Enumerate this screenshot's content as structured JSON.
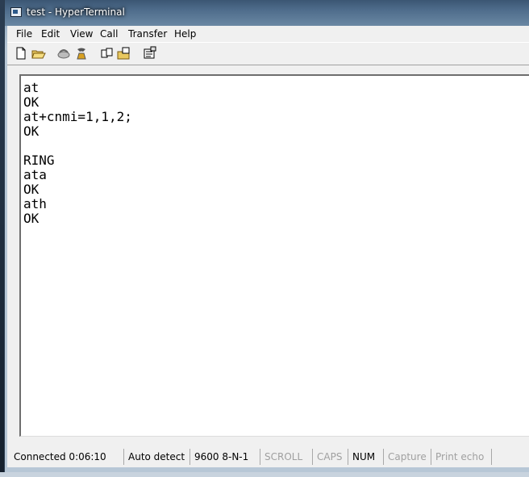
{
  "window": {
    "title": "test - HyperTerminal"
  },
  "menu": [
    "File",
    "Edit",
    "View",
    "Call",
    "Transfer",
    "Help"
  ],
  "toolbar": [
    {
      "name": "new-connection-icon"
    },
    {
      "name": "open-icon"
    },
    {
      "name": "connect-icon"
    },
    {
      "name": "disconnect-icon"
    },
    {
      "name": "send-icon"
    },
    {
      "name": "receive-icon"
    },
    {
      "name": "properties-icon"
    }
  ],
  "terminal": {
    "lines": [
      "at",
      "OK",
      "at+cnmi=1,1,2;",
      "OK",
      "",
      "RING",
      "ata",
      "OK",
      "ath",
      "OK"
    ]
  },
  "status": {
    "connected": "Connected 0:06:10",
    "detect": "Auto detect",
    "settings": "9600 8-N-1",
    "scroll": "SCROLL",
    "caps": "CAPS",
    "num": "NUM",
    "capture": "Capture",
    "print_echo": "Print echo"
  }
}
